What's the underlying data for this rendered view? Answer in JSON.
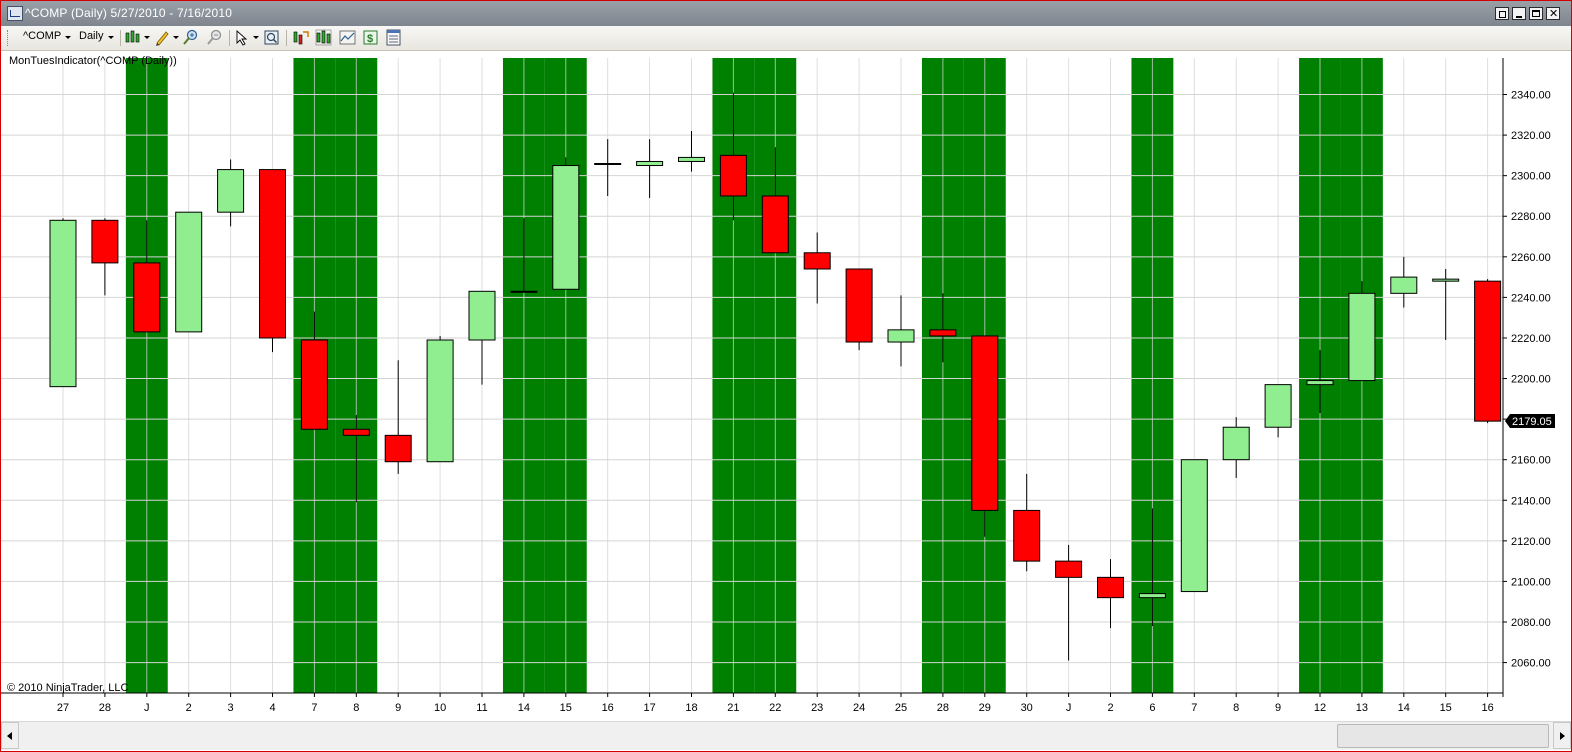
{
  "window": {
    "title": "^COMP (Daily)  5/27/2010 - 7/16/2010",
    "frame_color": "#d40000"
  },
  "toolbar": {
    "instrument": "^COMP",
    "interval": "Daily",
    "icons": [
      "bar-type-icon",
      "drawing-pencil-icon",
      "zoom-in-icon",
      "zoom-out-icon",
      "pointer-icon",
      "data-box-icon",
      "strategies-icon",
      "indicators-icon",
      "chart-properties-icon",
      "market-analyzer-icon",
      "panel-icon"
    ]
  },
  "indicator_label": "MonTuesIndicator(^COMP (Daily))",
  "copyright": "© 2010 NinjaTrader, LLC",
  "colors": {
    "up_body": "#90ee90",
    "down_body": "#ff0000",
    "highlight_band": "#008000",
    "price_marker_bg": "#000000",
    "price_marker_text": "#ffffff"
  },
  "chart_data": {
    "type": "candlestick",
    "ylim": [
      2045,
      2358
    ],
    "yticks": [
      2060,
      2080,
      2100,
      2120,
      2140,
      2160,
      2180,
      2200,
      2220,
      2240,
      2260,
      2280,
      2300,
      2320,
      2340
    ],
    "ytick_labels": [
      "2060.00",
      "2080.00",
      "2100.00",
      "2120.00",
      "2140.00",
      "2160.00",
      "2180.00",
      "2200.00",
      "2220.00",
      "2240.00",
      "2260.00",
      "2280.00",
      "2300.00",
      "2320.00",
      "2340.00"
    ],
    "grid": true,
    "last_price": "2179.05",
    "categories": [
      "27",
      "28",
      "J",
      "2",
      "3",
      "4",
      "7",
      "8",
      "9",
      "10",
      "11",
      "14",
      "15",
      "16",
      "17",
      "18",
      "21",
      "22",
      "23",
      "24",
      "25",
      "28",
      "29",
      "30",
      "J",
      "2",
      "6",
      "7",
      "8",
      "9",
      "12",
      "13",
      "14",
      "15",
      "16"
    ],
    "highlighted": [
      false,
      false,
      true,
      false,
      false,
      false,
      true,
      true,
      false,
      false,
      false,
      true,
      true,
      false,
      false,
      false,
      true,
      true,
      false,
      false,
      false,
      true,
      true,
      false,
      false,
      false,
      true,
      false,
      false,
      false,
      true,
      true,
      false,
      false,
      false
    ],
    "open": [
      2196,
      2278,
      2257,
      2223,
      2282,
      2303,
      2219,
      2175,
      2172,
      2159,
      2219,
      2243,
      2244,
      2306,
      2305,
      2307,
      2310,
      2290,
      2262,
      2254,
      2218,
      2224,
      2221,
      2135,
      2110,
      2102,
      2092,
      2095,
      2160,
      2176,
      2197,
      2199,
      2242,
      2248,
      2248
    ],
    "high": [
      2279,
      2279,
      2278,
      2282,
      2308,
      2303,
      2233,
      2182,
      2209,
      2221,
      2243,
      2279,
      2309,
      2318,
      2318,
      2322,
      2341,
      2314,
      2272,
      2254,
      2241,
      2242,
      2221,
      2153,
      2118,
      2111,
      2136,
      2160,
      2181,
      2197,
      2214,
      2248,
      2260,
      2254,
      2249
    ],
    "low": [
      2196,
      2241,
      2223,
      2223,
      2275,
      2213,
      2175,
      2139,
      2153,
      2159,
      2197,
      2243,
      2244,
      2290,
      2289,
      2302,
      2278,
      2262,
      2237,
      2214,
      2206,
      2208,
      2122,
      2105,
      2061,
      2077,
      2078,
      2095,
      2151,
      2171,
      2183,
      2199,
      2235,
      2219,
      2178
    ],
    "close": [
      2278,
      2257,
      2223,
      2282,
      2303,
      2220,
      2175,
      2172,
      2159,
      2219,
      2243,
      2243,
      2305,
      2306,
      2307,
      2309,
      2290,
      2262,
      2254,
      2218,
      2224,
      2221,
      2135,
      2110,
      2102,
      2092,
      2094,
      2160,
      2176,
      2197,
      2199,
      2242,
      2250,
      2249,
      2179
    ]
  }
}
